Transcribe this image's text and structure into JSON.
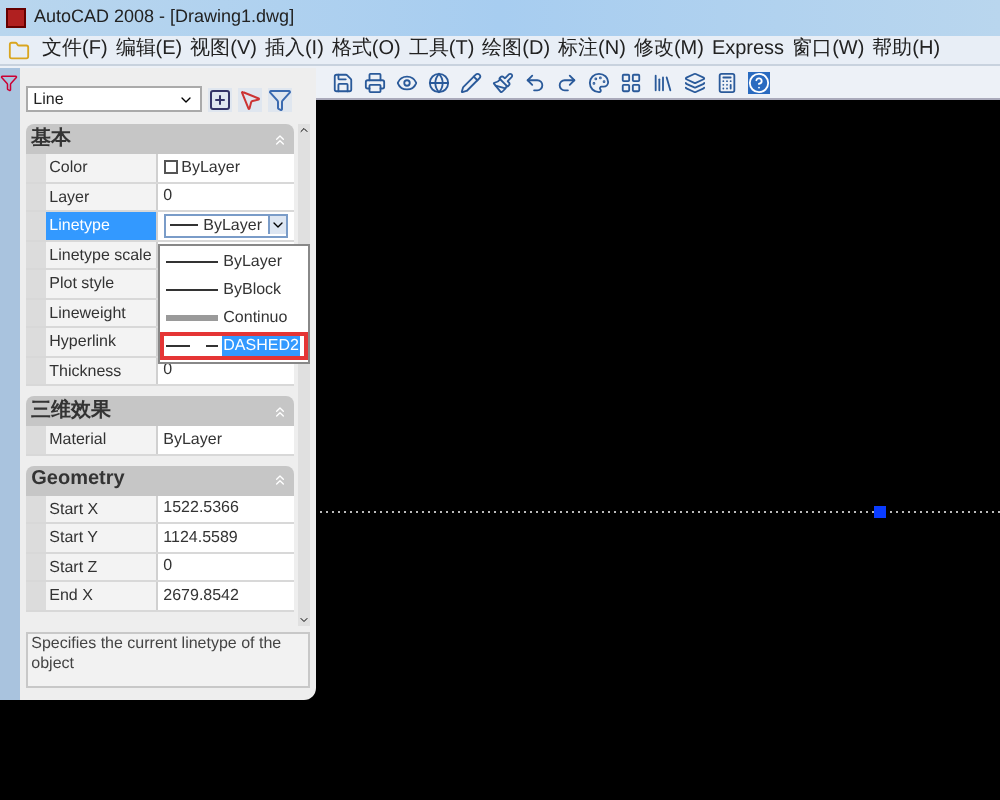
{
  "window": {
    "title": "AutoCAD 2008 - [Drawing1.dwg]"
  },
  "menu": [
    "文件(F)",
    "编辑(E)",
    "视图(V)",
    "插入(I)",
    "格式(O)",
    "工具(T)",
    "绘图(D)",
    "标注(N)",
    "修改(M)",
    "Express",
    "窗口(W)",
    "帮助(H)"
  ],
  "properties": {
    "object_type": "Line",
    "sections": [
      {
        "title": "基本",
        "expanded": true,
        "rows": [
          {
            "name": "Color",
            "value": "ByLayer",
            "kind": "color",
            "selected": false
          },
          {
            "name": "Layer",
            "value": "0",
            "kind": "text",
            "selected": false
          },
          {
            "name": "Linetype",
            "value": "ByLayer",
            "kind": "dropdown",
            "selected": true
          },
          {
            "name": "Linetype scale",
            "kind": "text",
            "selected": false
          },
          {
            "name": "Plot style",
            "kind": "text",
            "selected": false
          },
          {
            "name": "Lineweight",
            "kind": "text",
            "selected": false
          },
          {
            "name": "Hyperlink",
            "kind": "text",
            "selected": false
          },
          {
            "name": "Thickness",
            "value": "0",
            "kind": "text",
            "selected": false
          }
        ]
      },
      {
        "title": "三维效果",
        "expanded": true,
        "rows": [
          {
            "name": "Material",
            "value": "ByLayer",
            "kind": "text",
            "selected": false
          }
        ]
      },
      {
        "title": "Geometry",
        "expanded": true,
        "rows": [
          {
            "name": "Start X",
            "value": "1522.5366",
            "kind": "text",
            "selected": false
          },
          {
            "name": "Start Y",
            "value": "1124.5589",
            "kind": "text",
            "selected": false
          },
          {
            "name": "Start Z",
            "value": "0",
            "kind": "text",
            "selected": false
          },
          {
            "name": "End X",
            "value": "2679.8542",
            "kind": "text",
            "selected": false
          }
        ]
      }
    ],
    "description": "Specifies the current linetype of the object"
  },
  "linetype_dropdown": [
    {
      "label": "ByLayer",
      "kind": "solid",
      "selected": false,
      "annotated": false
    },
    {
      "label": "ByBlock",
      "kind": "solid",
      "selected": false,
      "annotated": false
    },
    {
      "label": "Continuo",
      "kind": "thick",
      "selected": false,
      "annotated": false
    },
    {
      "label": "DASHED2",
      "kind": "dashed",
      "selected": true,
      "annotated": true
    }
  ]
}
